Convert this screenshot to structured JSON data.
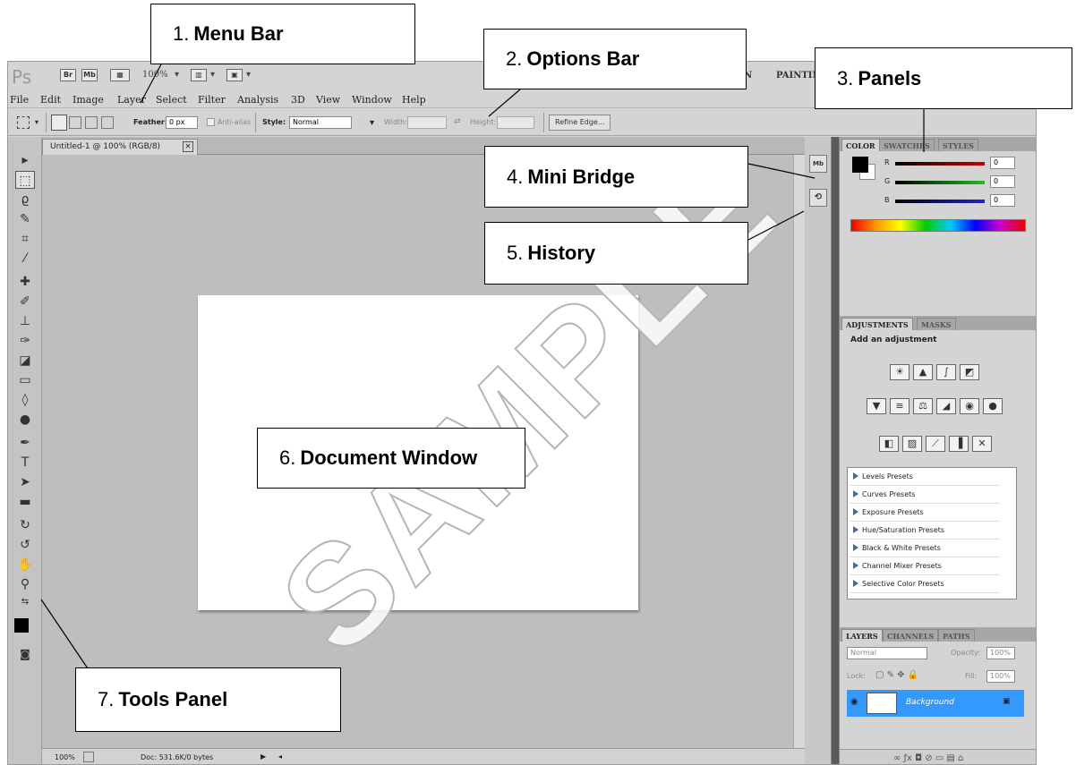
{
  "app": {
    "logo": "Ps",
    "bridge_btn": "Br",
    "minibridge_btn": "Mb",
    "zoom": "100%",
    "workspaces": [
      "N",
      "PAINTIN"
    ]
  },
  "menu": [
    "File",
    "Edit",
    "Image",
    "Layer",
    "Select",
    "Filter",
    "Analysis",
    "3D",
    "View",
    "Window",
    "Help"
  ],
  "options": {
    "feather_label": "Feather:",
    "feather_value": "0 px",
    "antialias_label": "Anti-alias",
    "style_label": "Style:",
    "style_value": "Normal",
    "width_label": "Width:",
    "height_label": "Height:",
    "refine_label": "Refine Edge..."
  },
  "document": {
    "tab_title": "Untitled-1 @ 100% (RGB/8)",
    "status_zoom": "100%",
    "status_doc": "Doc: 531.6K/0 bytes"
  },
  "color_panel": {
    "tabs": [
      "COLOR",
      "SWATCHES",
      "STYLES"
    ],
    "channels": [
      {
        "label": "R",
        "value": "0",
        "color": "#cc0000"
      },
      {
        "label": "G",
        "value": "0",
        "color": "#22bb22"
      },
      {
        "label": "B",
        "value": "0",
        "color": "#2222cc"
      }
    ]
  },
  "adjustments": {
    "tabs": [
      "ADJUSTMENTS",
      "MASKS"
    ],
    "heading": "Add an adjustment",
    "presets": [
      "Levels Presets",
      "Curves Presets",
      "Exposure Presets",
      "Hue/Saturation Presets",
      "Black & White Presets",
      "Channel Mixer Presets",
      "Selective Color Presets"
    ]
  },
  "layers": {
    "tabs": [
      "LAYERS",
      "CHANNELS",
      "PATHS"
    ],
    "blend_mode": "Normal",
    "opacity_label": "Opacity:",
    "opacity_value": "100%",
    "lock_label": "Lock:",
    "fill_label": "Fill:",
    "fill_value": "100%",
    "layer_name": "Background",
    "selected_color": "#3399ff"
  },
  "callouts": {
    "menu_bar": {
      "num": "1.",
      "label": "Menu Bar"
    },
    "options_bar": {
      "num": "2.",
      "label": "Options Bar"
    },
    "panels": {
      "num": "3.",
      "label": "Panels"
    },
    "mini_bridge": {
      "num": "4.",
      "label": "Mini Bridge"
    },
    "history": {
      "num": "5.",
      "label": "History"
    },
    "document_window": {
      "num": "6.",
      "label": "Document Window"
    },
    "tools_panel": {
      "num": "7.",
      "label": "Tools Panel"
    }
  },
  "watermark": "SAMPLE"
}
